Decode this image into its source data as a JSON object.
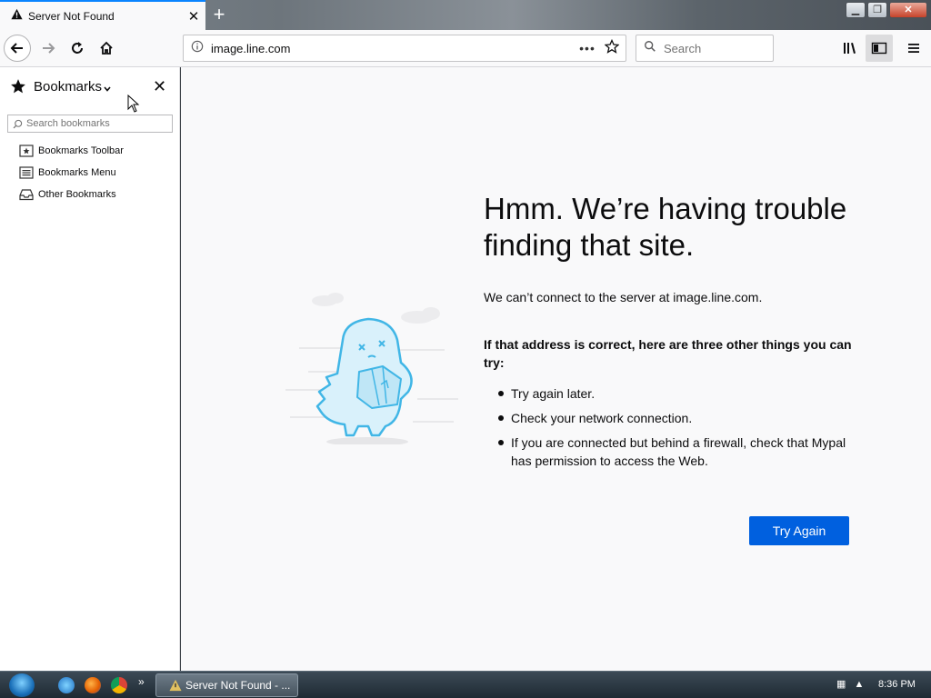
{
  "tab": {
    "title": "Server Not Found",
    "icon": "warning-icon"
  },
  "urlbar": {
    "url": "image.line.com"
  },
  "searchbar": {
    "placeholder": "Search"
  },
  "sidebar": {
    "title": "Bookmarks",
    "search_placeholder": "Search bookmarks",
    "items": [
      {
        "label": "Bookmarks Toolbar",
        "icon": "bookmarks-toolbar-icon"
      },
      {
        "label": "Bookmarks Menu",
        "icon": "bookmarks-menu-icon"
      },
      {
        "label": "Other Bookmarks",
        "icon": "other-bookmarks-icon"
      }
    ]
  },
  "error": {
    "title": "Hmm. We’re having trouble finding that site.",
    "description": "We can’t connect to the server at image.line.com.",
    "suggestions_title": "If that address is correct, here are three other things you can try:",
    "suggestions": [
      "Try again later.",
      "Check your network connection.",
      "If you are connected but behind a firewall, check that Mypal has permission to access the Web."
    ],
    "button": "Try Again"
  },
  "taskbar": {
    "app_label": "Server Not Found - ...",
    "time": "8:36 PM"
  },
  "colors": {
    "accent": "#0060df",
    "tab_highlight": "#0a84ff",
    "illustration": "#41b6e6"
  }
}
